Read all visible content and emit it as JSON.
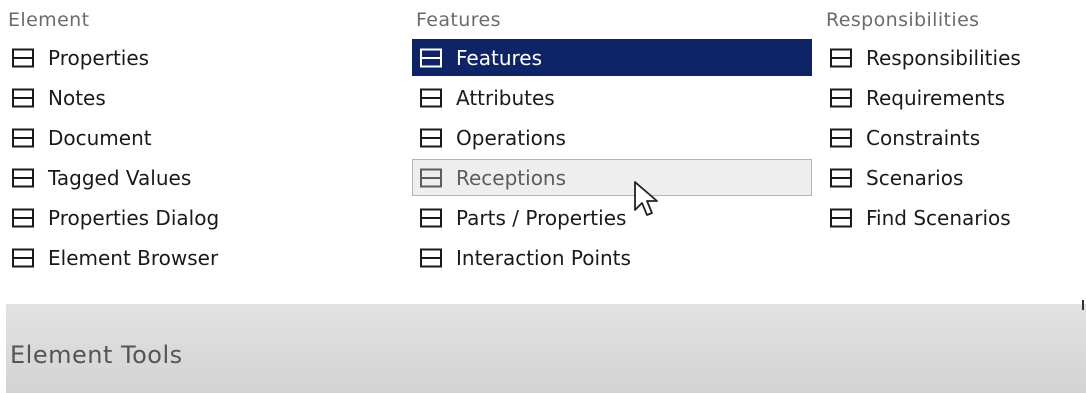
{
  "columns": {
    "element": {
      "header": "Element",
      "items": [
        {
          "label": "Properties"
        },
        {
          "label": "Notes"
        },
        {
          "label": "Document"
        },
        {
          "label": "Tagged Values"
        },
        {
          "label": "Properties Dialog"
        },
        {
          "label": "Element Browser"
        }
      ]
    },
    "features": {
      "header": "Features",
      "items": [
        {
          "label": "Features",
          "state": "selected"
        },
        {
          "label": "Attributes"
        },
        {
          "label": "Operations"
        },
        {
          "label": "Receptions",
          "state": "hover"
        },
        {
          "label": "Parts / Properties"
        },
        {
          "label": "Interaction Points"
        }
      ]
    },
    "responsibilities": {
      "header": "Responsibilities",
      "items": [
        {
          "label": "Responsibilities"
        },
        {
          "label": "Requirements"
        },
        {
          "label": "Constraints"
        },
        {
          "label": "Scenarios"
        },
        {
          "label": "Find Scenarios"
        }
      ]
    }
  },
  "footer": {
    "title": "Element Tools"
  },
  "icons": {
    "item_icon": "window-panel-icon",
    "cursor": "mouse-pointer-icon"
  },
  "colors": {
    "selected_bg": "#0f2466",
    "hover_bg": "#eeeeee",
    "header_text": "#6b6b6b",
    "footer_bg": "#dadada"
  }
}
